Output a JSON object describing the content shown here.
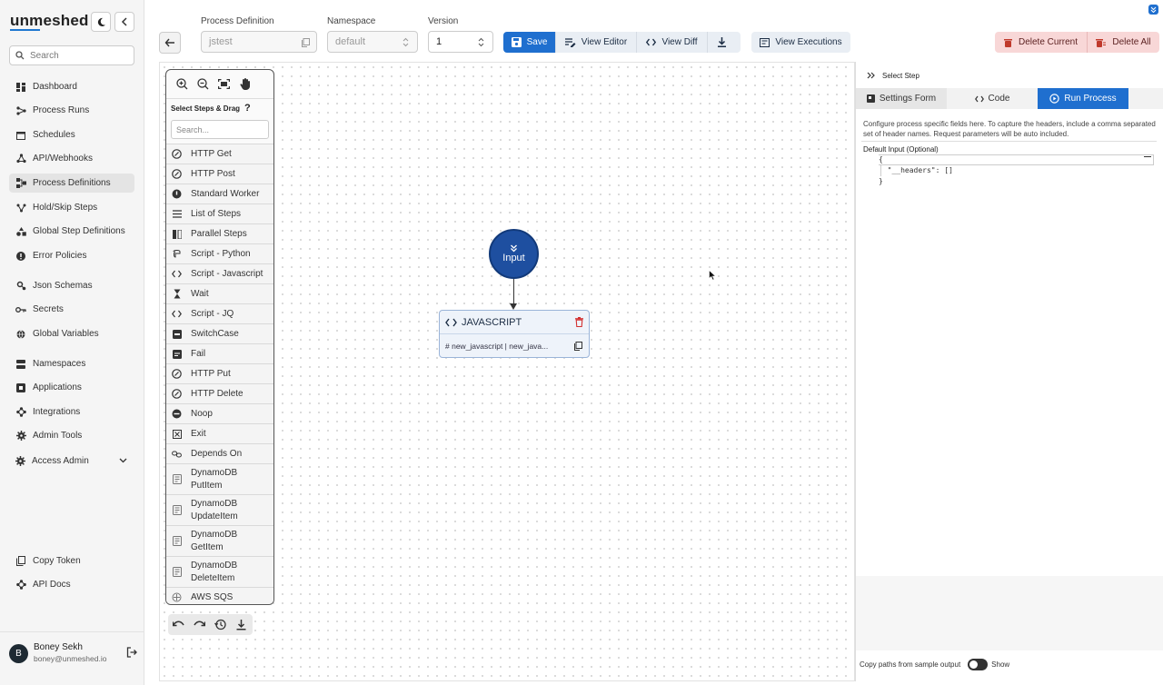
{
  "app": {
    "logo": "unmeshed"
  },
  "sidebar": {
    "search_placeholder": "Search",
    "items": [
      {
        "label": "Dashboard",
        "icon": "dashboard-icon"
      },
      {
        "label": "Process Runs",
        "icon": "process-runs-icon"
      },
      {
        "label": "Schedules",
        "icon": "calendar-icon"
      },
      {
        "label": "API/Webhooks",
        "icon": "webhook-icon"
      },
      {
        "label": "Process Definitions",
        "icon": "process-definitions-icon",
        "active": true
      },
      {
        "label": "Hold/Skip Steps",
        "icon": "hold-skip-icon"
      },
      {
        "label": "Global Step Definitions",
        "icon": "shapes-icon"
      },
      {
        "label": "Error Policies",
        "icon": "error-icon"
      },
      {
        "label": "Json Schemas",
        "icon": "schema-icon"
      },
      {
        "label": "Secrets",
        "icon": "key-icon"
      },
      {
        "label": "Global Variables",
        "icon": "globe-icon"
      },
      {
        "label": "Namespaces",
        "icon": "namespaces-icon"
      },
      {
        "label": "Applications",
        "icon": "applications-icon"
      },
      {
        "label": "Integrations",
        "icon": "integrations-icon"
      },
      {
        "label": "Admin Tools",
        "icon": "gear-icon"
      },
      {
        "label": "Access Admin",
        "icon": "access-admin-icon"
      },
      {
        "label": "Copy Token",
        "icon": "copy-icon"
      },
      {
        "label": "API Docs",
        "icon": "api-docs-icon"
      }
    ],
    "user": {
      "initial": "B",
      "name": "Boney Sekh",
      "email": "boney@unmeshed.io"
    }
  },
  "topbar": {
    "process_definition_label": "Process Definition",
    "process_definition_value": "jstest",
    "namespace_label": "Namespace",
    "namespace_value": "default",
    "version_label": "Version",
    "version_value": "1",
    "save": "Save",
    "view_editor": "View Editor",
    "view_diff": "View Diff",
    "view_executions": "View Executions",
    "delete_current": "Delete Current",
    "delete_all": "Delete All"
  },
  "palette": {
    "title": "Select Steps & Drag",
    "help": "?",
    "search_placeholder": "Search...",
    "items": [
      {
        "label": "HTTP Get",
        "icon": "http-icon"
      },
      {
        "label": "HTTP Post",
        "icon": "http-icon"
      },
      {
        "label": "Standard Worker",
        "icon": "worker-icon"
      },
      {
        "label": "List of Steps",
        "icon": "list-icon"
      },
      {
        "label": "Parallel Steps",
        "icon": "parallel-icon"
      },
      {
        "label": "Script - Python",
        "icon": "python-icon"
      },
      {
        "label": "Script - Javascript",
        "icon": "code-icon"
      },
      {
        "label": "Wait",
        "icon": "hourglass-icon"
      },
      {
        "label": "Script - JQ",
        "icon": "code-icon"
      },
      {
        "label": "SwitchCase",
        "icon": "switch-icon"
      },
      {
        "label": "Fail",
        "icon": "fail-icon"
      },
      {
        "label": "HTTP Put",
        "icon": "http-icon"
      },
      {
        "label": "HTTP Delete",
        "icon": "http-icon"
      },
      {
        "label": "Noop",
        "icon": "noop-icon"
      },
      {
        "label": "Exit",
        "icon": "exit-icon"
      },
      {
        "label": "Depends On",
        "icon": "link-icon"
      },
      {
        "label": "DynamoDB PutItem",
        "icon": "dynamodb-icon"
      },
      {
        "label": "DynamoDB UpdateItem",
        "icon": "dynamodb-icon"
      },
      {
        "label": "DynamoDB GetItem",
        "icon": "dynamodb-icon"
      },
      {
        "label": "DynamoDB DeleteItem",
        "icon": "dynamodb-icon"
      },
      {
        "label": "AWS SQS",
        "icon": "sqs-icon"
      }
    ]
  },
  "flow": {
    "input_node": "Input",
    "js_node_title": "JAVASCRIPT",
    "js_node_ref": "# new_javascript | new_java..."
  },
  "panel": {
    "header": "Select Step",
    "tabs": [
      "Settings Form",
      "Code",
      "Run Process"
    ],
    "active_tab": "Run Process",
    "description": "Configure process specific fields here. To capture the headers, include a comma separated set of header names. Request parameters will be auto included.",
    "input_label": "Default Input (Optional)",
    "code_lines": [
      "{",
      "  \"__headers\": []",
      "}"
    ],
    "copy_paths_label": "Copy paths from sample output",
    "show_label": "Show"
  }
}
